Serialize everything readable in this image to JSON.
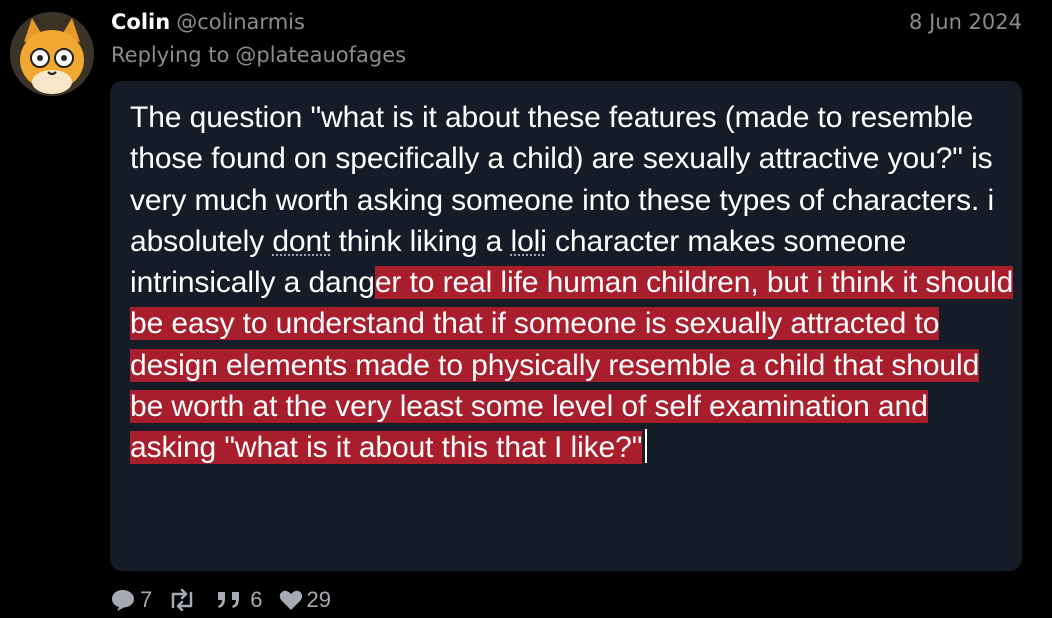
{
  "tweet": {
    "author_name": "Colin",
    "author_handle": "@colinarmis",
    "date": "8 Jun 2024",
    "replying_label": "Replying to",
    "replying_to": "@plateauofages",
    "text": {
      "part1": "The question \"what is it about these features (made to resemble those found on specifically a child) are sexually attractive you?\"  is very much worth asking someone into these types of characters. i absolutely ",
      "spell1": "dont",
      "part2": " think liking a ",
      "spell2": "loli",
      "part3": " character makes someone intrinsically a dang",
      "highlighted": "er to real life human children, but i think it should be easy to understand that if someone is sexually attracted to design elements made to physically resemble a child that should be worth at the very least some level of self examination and asking \"what is it about this that I like?\""
    },
    "highlight_color": "#a81e2c",
    "card_color": "#151b27"
  },
  "actions": {
    "replies": "7",
    "retweets": "",
    "quotes": "6",
    "likes": "29"
  },
  "icons": {
    "avatar": "cartoon-cat-avatar",
    "reply": "speech-bubble-icon",
    "retweet": "retweet-icon",
    "quote": "quote-icon",
    "like": "heart-icon"
  }
}
